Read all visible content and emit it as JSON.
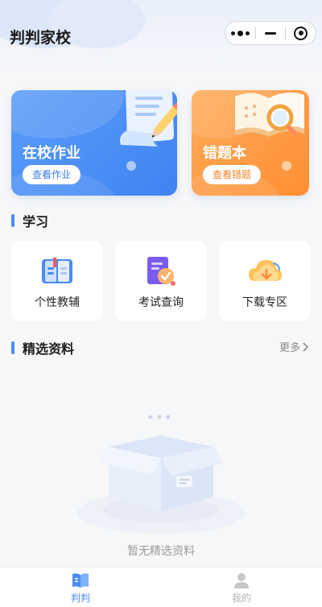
{
  "header": {
    "title": "判判家校"
  },
  "cards": [
    {
      "title": "在校作业",
      "button": "查看作业"
    },
    {
      "title": "错题本",
      "button": "查看错题"
    }
  ],
  "study": {
    "title": "学习",
    "items": [
      {
        "label": "个性教辅",
        "icon": "book-icon"
      },
      {
        "label": "考试查询",
        "icon": "exam-query-icon"
      },
      {
        "label": "下载专区",
        "icon": "cloud-download-icon"
      }
    ]
  },
  "featured": {
    "title": "精选资料",
    "more": "更多",
    "empty_text": "暂无精选资料"
  },
  "tabbar": {
    "items": [
      {
        "label": "判判",
        "active": true
      },
      {
        "label": "我的",
        "active": false
      }
    ]
  },
  "colors": {
    "accent": "#4a8cf5",
    "card_blue": "#3f83f0",
    "card_orange": "#ff8f33"
  }
}
